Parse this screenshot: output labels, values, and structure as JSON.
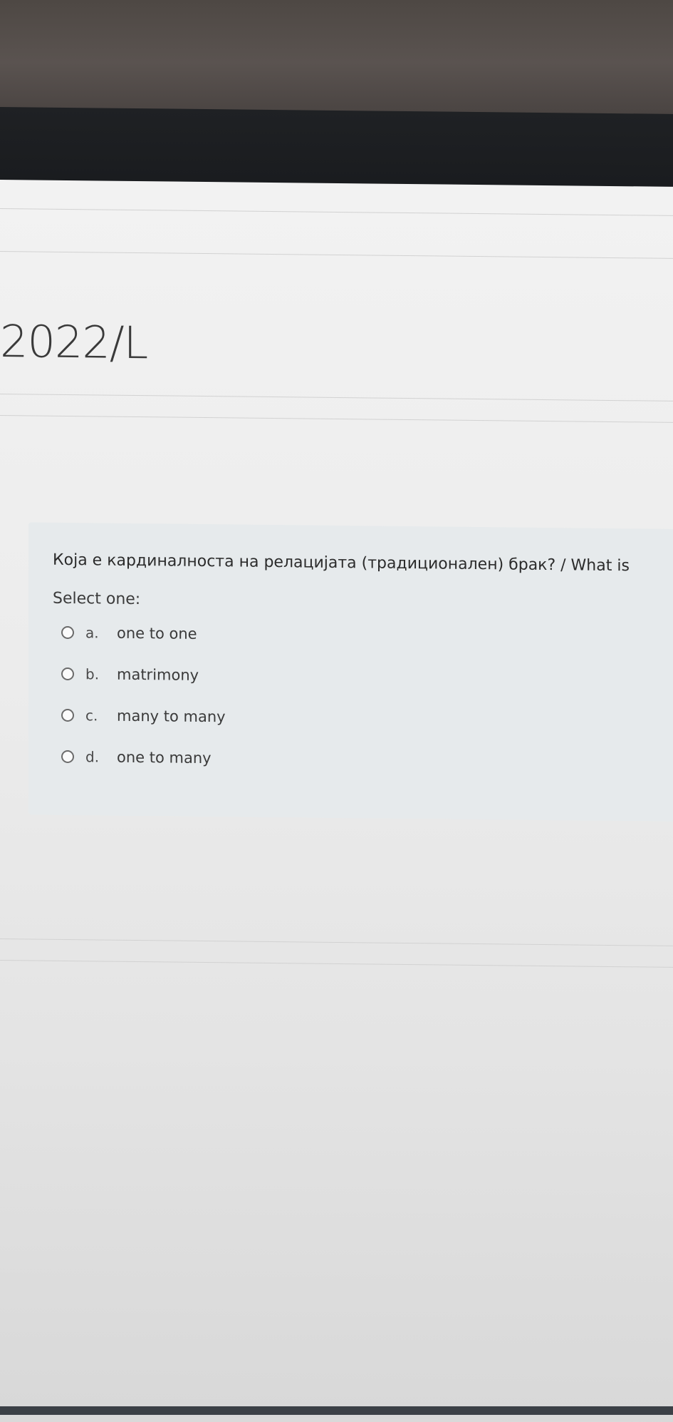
{
  "course": {
    "title_fragment": "2022/L"
  },
  "question": {
    "text": "Која е кардиналноста на релацијата (традиционален) брак? / What is",
    "prompt": "Select one:",
    "options": [
      {
        "letter": "a.",
        "label": "one to one"
      },
      {
        "letter": "b.",
        "label": "matrimony"
      },
      {
        "letter": "c.",
        "label": "many to many"
      },
      {
        "letter": "d.",
        "label": "one to many"
      }
    ]
  },
  "colors": {
    "card_background": "#e6eaec",
    "screen_background": "#eeeeee",
    "bezel": "#1c1e21"
  }
}
